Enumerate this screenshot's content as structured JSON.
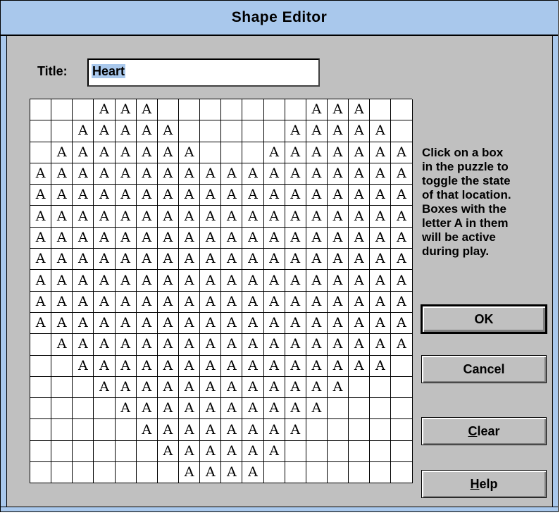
{
  "window": {
    "title": "Shape Editor"
  },
  "form": {
    "title_label": "Title:",
    "title_value": "Heart"
  },
  "puzzle": {
    "cell_letter": "A",
    "rows": [
      "...AAA.......AAA..",
      "..AAAAA.....AAAAA.",
      ".AAAAAAA...AAAAAAA",
      "AAAAAAAAAAAAAAAAAA",
      "AAAAAAAAAAAAAAAAAA",
      "AAAAAAAAAAAAAAAAAA",
      "AAAAAAAAAAAAAAAAAA",
      "AAAAAAAAAAAAAAAAAA",
      "AAAAAAAAAAAAAAAAAA",
      "AAAAAAAAAAAAAAAAAA",
      "AAAAAAAAAAAAAAAAAA",
      ".AAAAAAAAAAAAAAAAA",
      "..AAAAAAAAAAAAAAA.",
      "...AAAAAAAAAAAA...",
      "....AAAAAAAAAA....",
      ".....AAAAAAAA.....",
      "......AAAAAA......",
      ".......AAAA......."
    ]
  },
  "instructions": {
    "line1": "Click on a box",
    "line2": "in the puzzle to",
    "line3": "toggle the state",
    "line4": "of that location.",
    "line5": "Boxes with the",
    "line6": "letter A in them",
    "line7": "will be active",
    "line8": "during play."
  },
  "buttons": {
    "ok": "OK",
    "cancel": "Cancel",
    "clear_mnemonic": "C",
    "clear_rest": "lear",
    "help_mnemonic": "H",
    "help_rest": "elp"
  },
  "colors": {
    "titlebar": "#a9c8ec",
    "dialog_face": "#c0c0c0",
    "selection": "#a9c8ec"
  }
}
